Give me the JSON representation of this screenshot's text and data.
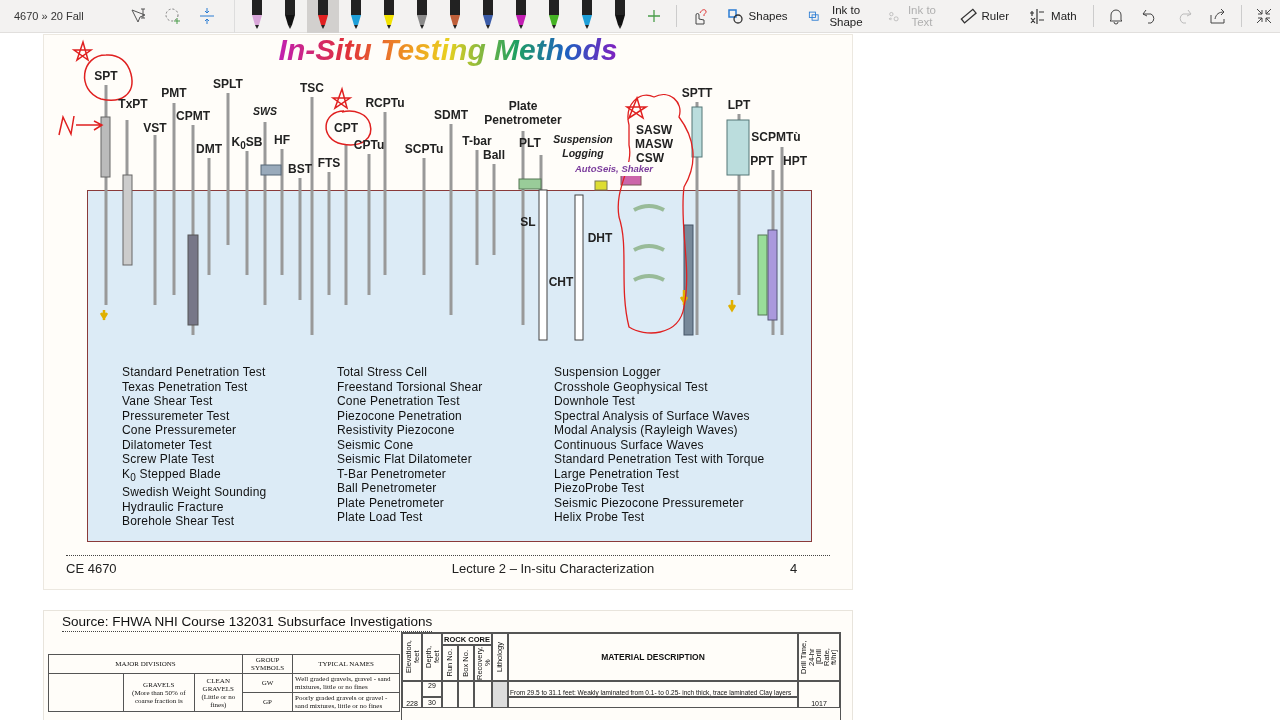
{
  "toolbar": {
    "breadcrumb": "4670 » 20 Fall",
    "pens": [
      {
        "color": "#d9a6d9",
        "selected": false
      },
      {
        "color": "#111111",
        "selected": false
      },
      {
        "color": "#e02020",
        "selected": true
      },
      {
        "color": "#1e9fd8",
        "selected": false
      },
      {
        "color": "#f2e200",
        "selected": false
      },
      {
        "color": "#8a8a8a",
        "selected": false
      },
      {
        "color": "#c0603a",
        "selected": false
      },
      {
        "color": "#3b5ca8",
        "selected": false
      },
      {
        "color": "#c21fb3",
        "selected": false
      },
      {
        "color": "#45b324",
        "selected": false
      },
      {
        "color": "#1e9fd8",
        "selected": false
      },
      {
        "color": "#111111",
        "selected": false
      }
    ],
    "tools": [
      {
        "label": "Shapes",
        "disabled": false
      },
      {
        "label": "Ink to Shape",
        "disabled": false
      },
      {
        "label": "Ink to Text",
        "disabled": true
      },
      {
        "label": "Ruler",
        "disabled": false
      },
      {
        "label": "Math",
        "disabled": false
      }
    ],
    "redo_disabled": true
  },
  "slide": {
    "title": "In-Situ Testing Methods",
    "labels": [
      {
        "lines": [
          "SPT"
        ],
        "kind": "abbreviation"
      },
      {
        "lines": [
          "TxPT"
        ],
        "kind": "abbreviation"
      },
      {
        "lines": [
          "VST"
        ],
        "kind": "abbreviation"
      },
      {
        "lines": [
          "PMT"
        ],
        "kind": "abbreviation"
      },
      {
        "lines": [
          "CPMT"
        ],
        "kind": "abbreviation"
      },
      {
        "lines": [
          "DMT"
        ],
        "kind": "abbreviation"
      },
      {
        "lines": [
          "SPLT"
        ],
        "kind": "abbreviation"
      },
      {
        "lines": [
          "SWS"
        ],
        "kind": "italic"
      },
      {
        "lines": [
          "K$_{0}$SB"
        ],
        "kind": "abbreviation"
      },
      {
        "lines": [
          "HF"
        ],
        "kind": "abbreviation"
      },
      {
        "lines": [
          "BST"
        ],
        "kind": "abbreviation"
      },
      {
        "lines": [
          "TSC"
        ],
        "kind": "abbreviation"
      },
      {
        "lines": [
          "FTS"
        ],
        "kind": "abbreviation"
      },
      {
        "lines": [
          "CPT"
        ],
        "kind": "abbreviation"
      },
      {
        "lines": [
          "RCPTu"
        ],
        "kind": "abbreviation"
      },
      {
        "lines": [
          "CPTu"
        ],
        "kind": "abbreviation"
      },
      {
        "lines": [
          "SCPTu"
        ],
        "kind": "abbreviation"
      },
      {
        "lines": [
          "SDMT"
        ],
        "kind": "abbreviation"
      },
      {
        "lines": [
          "T-bar"
        ],
        "kind": "abbreviation"
      },
      {
        "lines": [
          "Ball"
        ],
        "kind": "abbreviation"
      },
      {
        "lines": [
          "Plate",
          "Penetrometer"
        ],
        "kind": "abbreviation"
      },
      {
        "lines": [
          "PLT"
        ],
        "kind": "abbreviation"
      },
      {
        "lines": [
          "Suspension",
          "Logging"
        ],
        "kind": "italic"
      },
      {
        "lines": [
          "SASW"
        ],
        "kind": "abbreviation"
      },
      {
        "lines": [
          "MASW"
        ],
        "kind": "abbreviation"
      },
      {
        "lines": [
          "CSW"
        ],
        "kind": "abbreviation"
      },
      {
        "lines": [
          "AutoSeis, Shaker"
        ],
        "kind": "caption"
      },
      {
        "lines": [
          "SPTT"
        ],
        "kind": "abbreviation"
      },
      {
        "lines": [
          "LPT"
        ],
        "kind": "abbreviation"
      },
      {
        "lines": [
          "SCPMTù"
        ],
        "kind": "abbreviation"
      },
      {
        "lines": [
          "PPT"
        ],
        "kind": "abbreviation"
      },
      {
        "lines": [
          "HPT"
        ],
        "kind": "abbreviation"
      },
      {
        "lines": [
          "SL"
        ],
        "kind": "abbreviation"
      },
      {
        "lines": [
          "DHT"
        ],
        "kind": "abbreviation"
      },
      {
        "lines": [
          "CHT"
        ],
        "kind": "abbreviation"
      }
    ],
    "legend": [
      [
        "Standard Penetration Test",
        "Texas Penetration Test",
        "Vane Shear Test",
        "Pressuremeter Test",
        "Cone Pressuremeter",
        "Dilatometer Test",
        "Screw Plate Test",
        "K$_{0}$ Stepped Blade",
        "Swedish Weight Sounding",
        "Hydraulic Fracture",
        "Borehole Shear Test"
      ],
      [
        "Total Stress Cell",
        "Freestand Torsional Shear",
        "Cone Penetration Test",
        "Piezocone Penetration",
        "Resistivity Piezocone",
        "Seismic Cone",
        "Seismic Flat Dilatometer",
        "T-Bar Penetrometer",
        "Ball Penetrometer",
        "Plate Penetrometer",
        "Plate Load Test"
      ],
      [
        "Suspension Logger",
        "Crosshole Geophysical Test",
        "Downhole Test",
        "Spectral Analysis of Surface Waves",
        "Modal Analysis (Rayleigh Waves)",
        "Continuous Surface Waves",
        "Standard Penetration Test with Torque",
        "Large Penetration Test",
        "PiezoProbe Test",
        "Seismic Piezocone Pressuremeter",
        "Helix Probe Test"
      ]
    ],
    "footer": {
      "course": "CE 4670",
      "lecture": "Lecture 2 – In-situ Characterization",
      "page": "4"
    }
  },
  "slide2": {
    "source": "Source: FHWA NHI Course 132031 Subsurface Investigations",
    "soil_table": {
      "headers": [
        "MAJOR DIVISIONS",
        "GROUP SYMBOLS",
        "TYPICAL NAMES"
      ],
      "division": "GRAVELS",
      "division_note": "(More than 50% of coarse fraction is",
      "subdivision": "CLEAN GRAVELS",
      "subdivision_note": "(Little or no fines)",
      "rows": [
        {
          "symbol": "GW",
          "name": "Well graded gravels, gravel - sand mixtures, little or no fines"
        },
        {
          "symbol": "GP",
          "name": "Poorly graded gravels or gravel - sand mixtures, little or no fines"
        }
      ]
    },
    "log_table": {
      "headers": [
        "Elevation, feet",
        "Depth, feet",
        "Run No.",
        "Box No.",
        "Recovery, %",
        "Lithology"
      ],
      "group": "ROCK CORE",
      "description_header": "MATERIAL DESCRIPTION",
      "drill_header": "Drill Time, 24-hr [Drill Rate, ft/hr]",
      "depth_1": "29",
      "description": "From 29.5 to 31.1 feet: Weakly laminated from 0.1- to 0.25- inch thick, trace laminated Clay layers",
      "elevation_2": "228",
      "depth_2": "30",
      "drill_2": "1017"
    }
  }
}
